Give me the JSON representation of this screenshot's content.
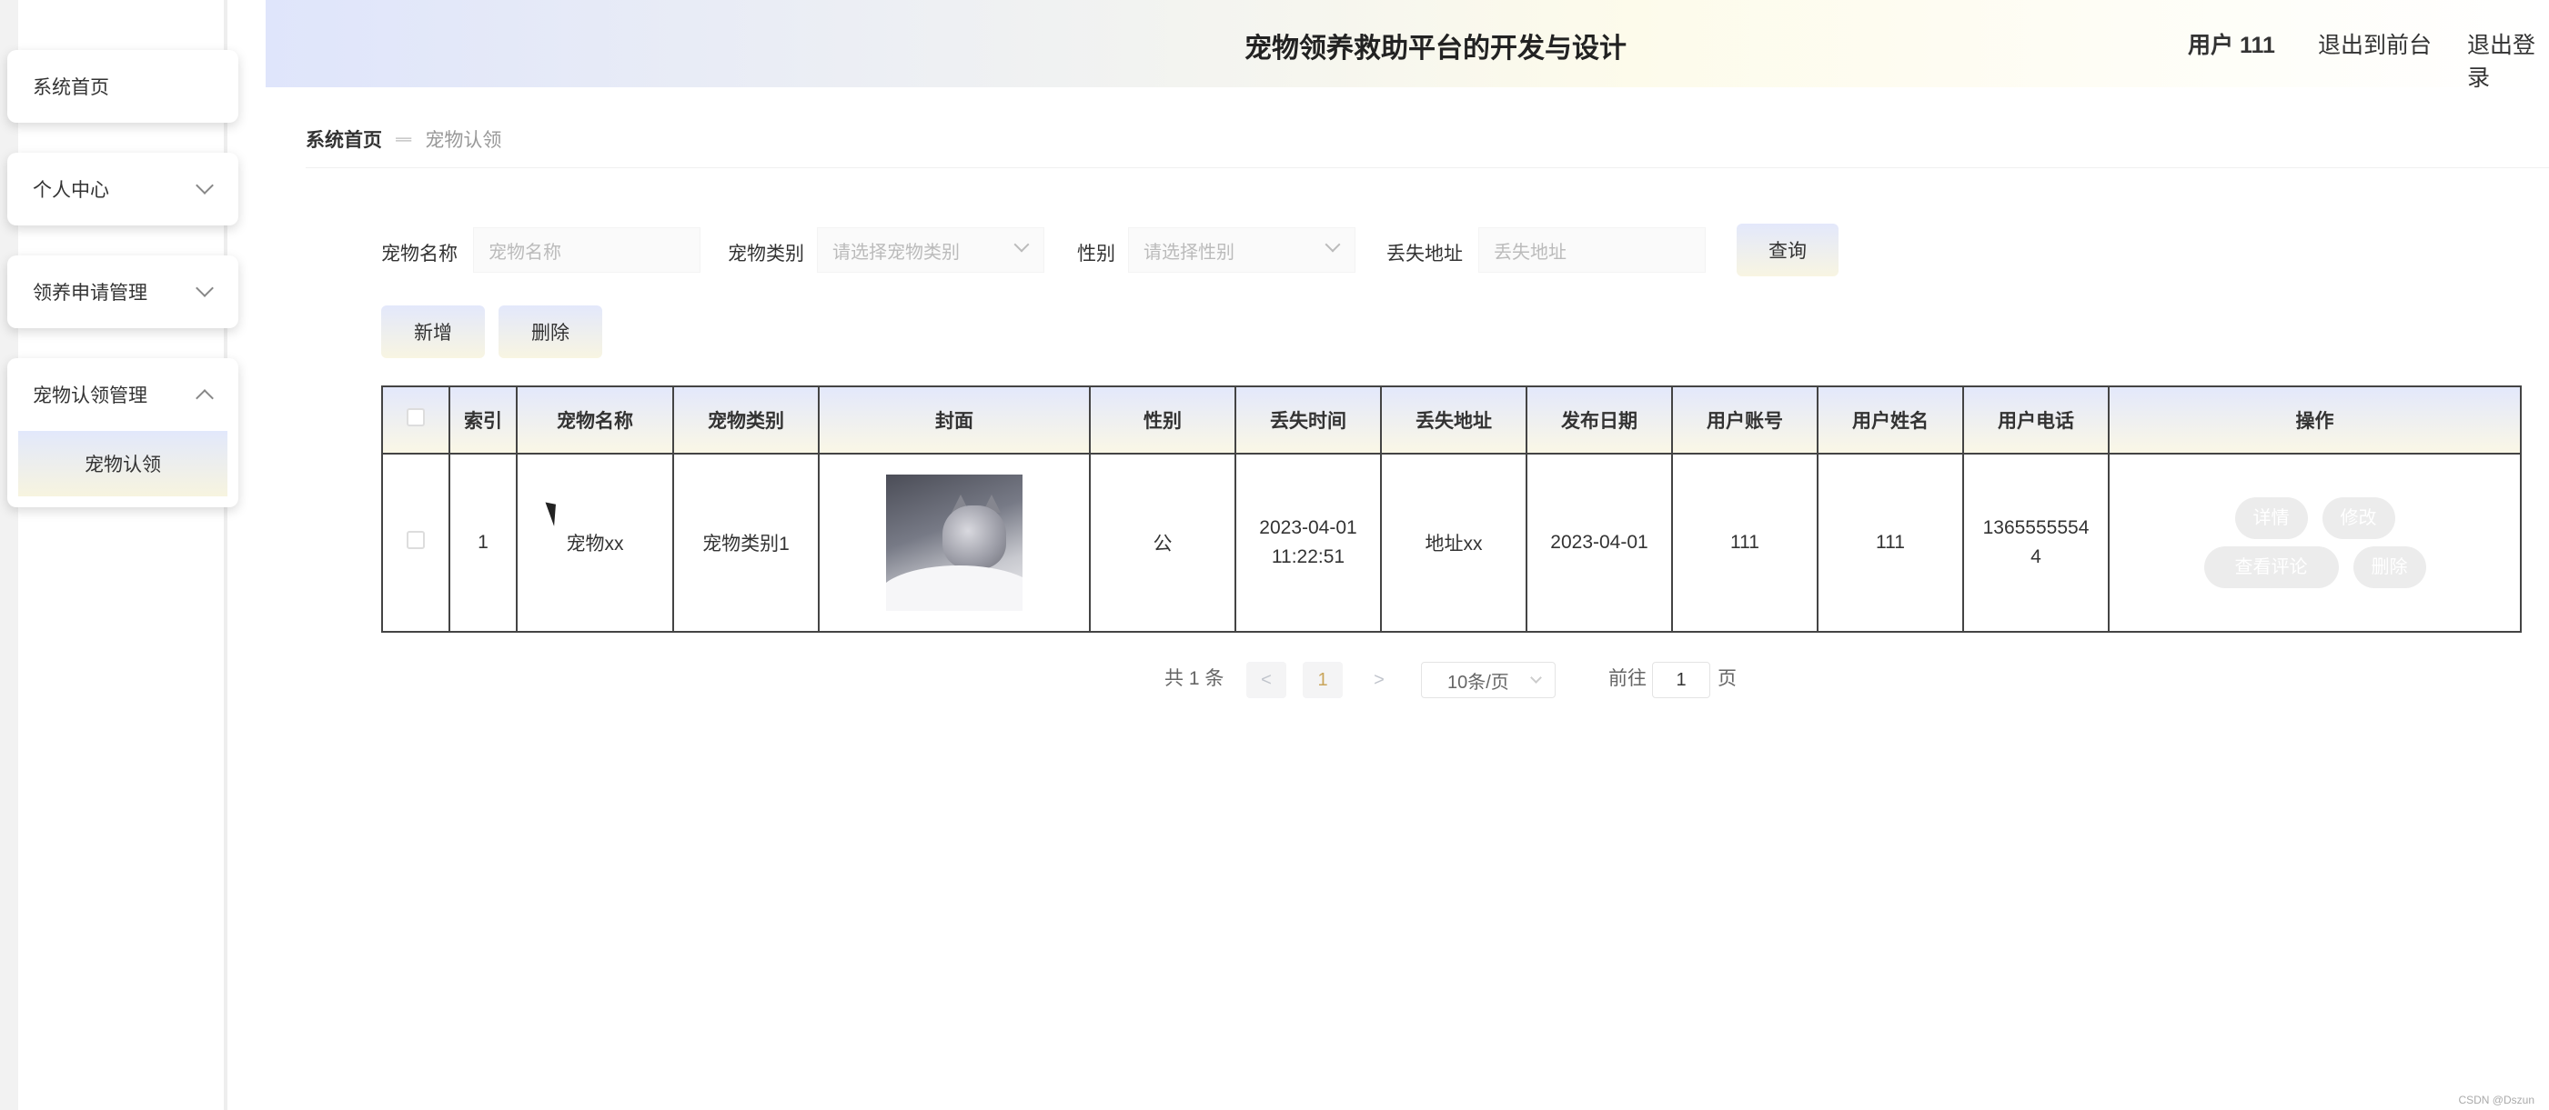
{
  "sidebar": {
    "items": [
      {
        "label": "系统首页"
      },
      {
        "label": "个人中心"
      },
      {
        "label": "领养申请管理"
      },
      {
        "label": "宠物认领管理",
        "children": [
          {
            "label": "宠物认领"
          }
        ]
      }
    ]
  },
  "header": {
    "title": "宠物领养救助平台的开发与设计",
    "user": "用户 111",
    "to_front": "退出到前台",
    "logout": "退出登录"
  },
  "breadcrumb": {
    "home": "系统首页",
    "separator": "ᆖ",
    "current": "宠物认领"
  },
  "filters": {
    "name": {
      "label": "宠物名称",
      "placeholder": "宠物名称"
    },
    "category": {
      "label": "宠物类别",
      "placeholder": "请选择宠物类别"
    },
    "gender": {
      "label": "性别",
      "placeholder": "请选择性别"
    },
    "address": {
      "label": "丢失地址",
      "placeholder": "丢失地址"
    },
    "query_label": "查询"
  },
  "actions": {
    "add_label": "新增",
    "delete_label": "删除"
  },
  "table": {
    "columns": [
      "",
      "索引",
      "宠物名称",
      "宠物类别",
      "封面",
      "性别",
      "丢失时间",
      "丢失地址",
      "发布日期",
      "用户账号",
      "用户姓名",
      "用户电话",
      "操作"
    ],
    "rows": [
      {
        "index": "1",
        "name": "宠物xx",
        "category": "宠物类别1",
        "gender": "公",
        "lost_time_date": "2023-04-01",
        "lost_time_clock": "11:22:51",
        "lost_address": "地址xx",
        "publish_date": "2023-04-01",
        "account": "111",
        "username": "111",
        "phone_line1": "1365555554",
        "phone_line2": "4",
        "ops": {
          "detail": "详情",
          "edit": "修改",
          "comments": "查看评论",
          "delete": "删除"
        }
      }
    ]
  },
  "pagination": {
    "total": "共 1 条",
    "prev": "<",
    "page": "1",
    "next": ">",
    "page_size": "10条/页",
    "goto_prefix": "前往",
    "goto_value": "1",
    "goto_suffix": "页"
  },
  "watermark": "CSDN @Dszun"
}
